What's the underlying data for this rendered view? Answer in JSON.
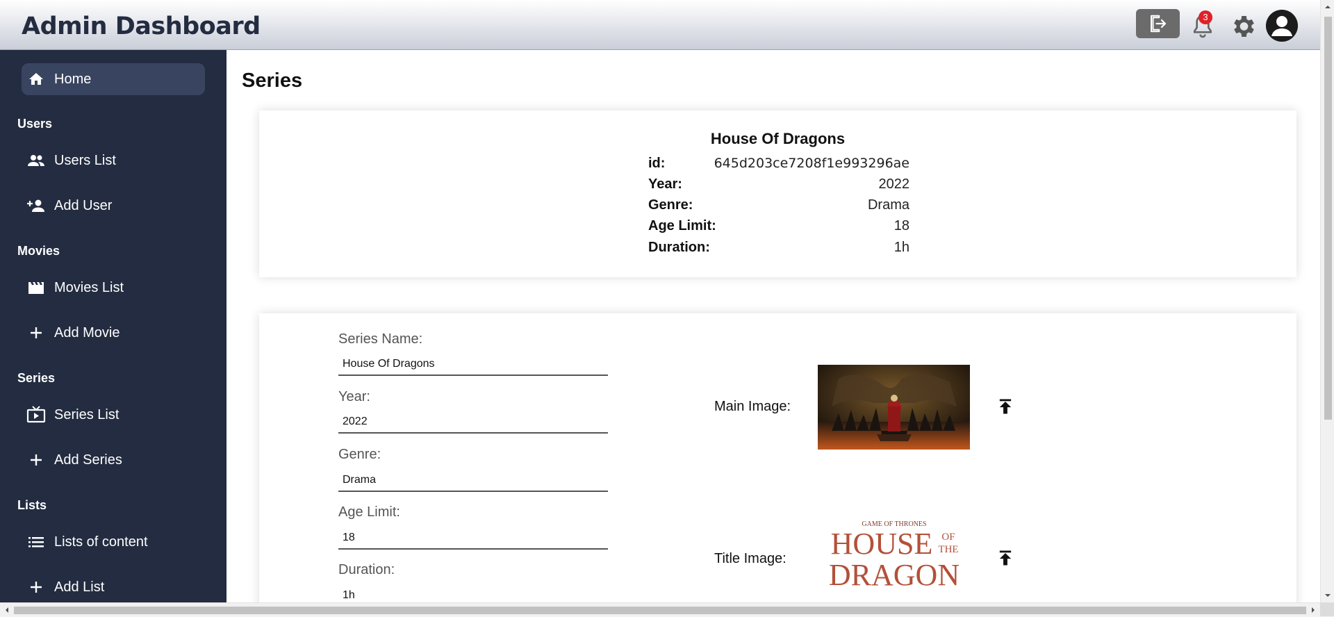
{
  "header": {
    "title": "Admin Dashboard",
    "notification_count": "3"
  },
  "sidebar": {
    "home": "Home",
    "sections": {
      "users": "Users",
      "movies": "Movies",
      "series": "Series",
      "lists": "Lists"
    },
    "items": {
      "users_list": "Users List",
      "add_user": "Add User",
      "movies_list": "Movies List",
      "add_movie": "Add Movie",
      "series_list": "Series List",
      "add_series": "Add Series",
      "lists_of_content": "Lists of content",
      "add_list": "Add List"
    }
  },
  "page": {
    "title": "Series"
  },
  "summary": {
    "name": "House Of Dragons",
    "rows": [
      {
        "label": "id:",
        "value": "645d203ce7208f1e993296ae"
      },
      {
        "label": "Year:",
        "value": "2022"
      },
      {
        "label": "Genre:",
        "value": "Drama"
      },
      {
        "label": "Age Limit:",
        "value": "18"
      },
      {
        "label": "Duration:",
        "value": "1h"
      }
    ]
  },
  "form": {
    "series_name_label": "Series Name:",
    "series_name_value": "House Of Dragons",
    "year_label": "Year:",
    "year_value": "2022",
    "genre_label": "Genre:",
    "genre_value": "Drama",
    "age_limit_label": "Age Limit:",
    "age_limit_value": "18",
    "duration_label": "Duration:",
    "duration_value": "1h",
    "main_image_label": "Main Image:",
    "title_image_label": "Title Image:",
    "title_image_text": {
      "top": "GAME OF THRONES",
      "line1": "HOUSE",
      "of": "OF",
      "the": "THE",
      "line2": "DRAGON"
    }
  },
  "colors": {
    "sidebar_bg": "#232c40",
    "sidebar_active": "#394560",
    "badge": "#e0202a",
    "logout_btn": "#6b6b6b"
  }
}
